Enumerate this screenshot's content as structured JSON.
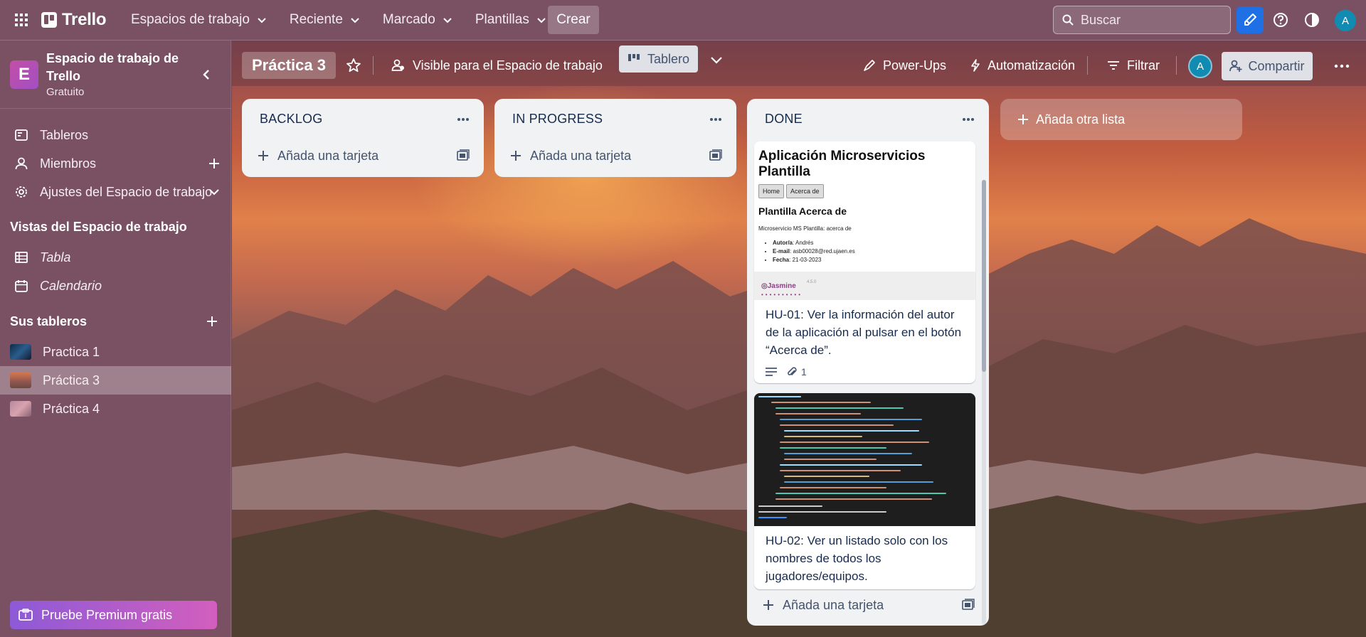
{
  "topbar": {
    "logo_text": "Trello",
    "nav": [
      {
        "label": "Espacios de trabajo"
      },
      {
        "label": "Reciente"
      },
      {
        "label": "Marcado"
      },
      {
        "label": "Plantillas"
      }
    ],
    "create_label": "Crear",
    "search_placeholder": "Buscar",
    "user_initial": "A"
  },
  "sidebar": {
    "workspace_initial": "E",
    "workspace_name": "Espacio de trabajo de Trello",
    "workspace_plan": "Gratuito",
    "items": [
      {
        "label": "Tableros",
        "icon": "board-icon"
      },
      {
        "label": "Miembros",
        "icon": "person-icon"
      },
      {
        "label": "Ajustes del Espacio de trabajo",
        "icon": "gear-icon"
      }
    ],
    "views_heading": "Vistas del Espacio de trabajo",
    "views": [
      {
        "label": "Tabla",
        "icon": "table-icon"
      },
      {
        "label": "Calendario",
        "icon": "calendar-icon"
      }
    ],
    "boards_heading": "Sus tableros",
    "boards": [
      {
        "label": "Practica 1",
        "active": false
      },
      {
        "label": "Práctica 3",
        "active": true
      },
      {
        "label": "Práctica 4",
        "active": false
      }
    ],
    "premium_label": "Pruebe Premium gratis"
  },
  "board": {
    "title": "Práctica 3",
    "visibility": "Visible para el Espacio de trabajo",
    "view_label": "Tablero",
    "powerups_label": "Power-Ups",
    "automation_label": "Automatización",
    "filter_label": "Filtrar",
    "member_initial": "A",
    "share_label": "Compartir",
    "add_list_label": "Añada otra lista"
  },
  "lists": [
    {
      "title": "BACKLOG",
      "add_card_label": "Añada una tarjeta"
    },
    {
      "title": "IN PROGRESS",
      "add_card_label": "Añada una tarjeta"
    },
    {
      "title": "DONE",
      "add_card_label": "Añada una tarjeta"
    }
  ],
  "cards": [
    {
      "title": "HU-01: Ver la información del autor de la aplicación al pulsar en el botón “Acerca de”.",
      "attachments": "1",
      "cover": {
        "heading": "Aplicación Microservicios Plantilla",
        "tabs": [
          "Home",
          "Acerca de"
        ],
        "subheading": "Plantilla Acerca de",
        "paragraph": "Microservicio MS Plantilla: acerca de",
        "rows": [
          {
            "key": "Autor/a",
            "value": ": Andrés"
          },
          {
            "key": "E-mail",
            "value": ": asb00028@red.ujaen.es"
          },
          {
            "key": "Fecha",
            "value": ": 21-03-2023"
          }
        ],
        "footer_brand": "Jasmine",
        "footer_version": "4.5.0"
      }
    },
    {
      "title": "HU-02: Ver un listado solo con los nombres de todos los jugadores/equipos."
    }
  ],
  "colors": {
    "topbar": "#7a5163",
    "sidebar": "#7a5163",
    "list_bg": "#f1f2f4",
    "primary_blue": "#1f6fe5",
    "avatar_teal": "#128bb3"
  }
}
